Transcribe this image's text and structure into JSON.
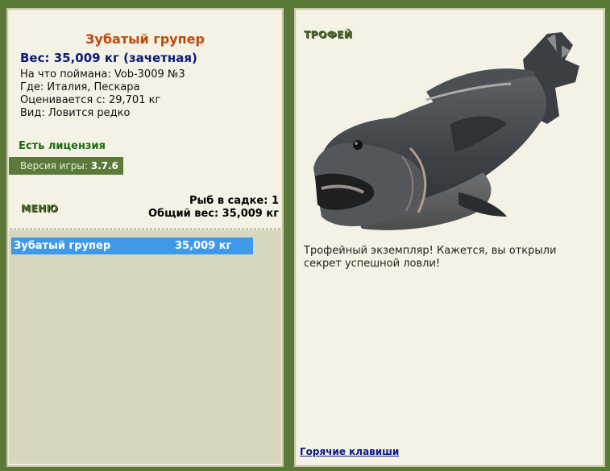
{
  "fish": {
    "title": "Зубатый групер",
    "weight_line": "Вес: 35,009 кг (зачетная)",
    "bait": "На что поймана: Vob-3009 №3",
    "location": "Где: Италия, Пескара",
    "value": "Оценивается с: 29,701 кг",
    "rarity": "Вид: Ловится редко"
  },
  "license": "Есть лицензия",
  "version": {
    "label": "Версия игры:",
    "value": "3.7.6"
  },
  "menu_label": "МЕНЮ",
  "stats": {
    "fish_count": "Рыб в садке: 1",
    "total_weight": "Общий вес: 35,009 кг"
  },
  "catch_list": [
    {
      "name": "Зубатый групер",
      "weight": "35,009 кг"
    }
  ],
  "trophy": {
    "label": "ТРОФЕЙ",
    "text": "Трофейный экземпляр! Кажется, вы открыли секрет успешной ловли!"
  },
  "hotkeys_link": "Горячие клавиши",
  "colors": {
    "frame": "#5b7a3a",
    "panel": "#f4f2e4",
    "highlight": "#3e9ae8",
    "title": "#c0480e"
  }
}
